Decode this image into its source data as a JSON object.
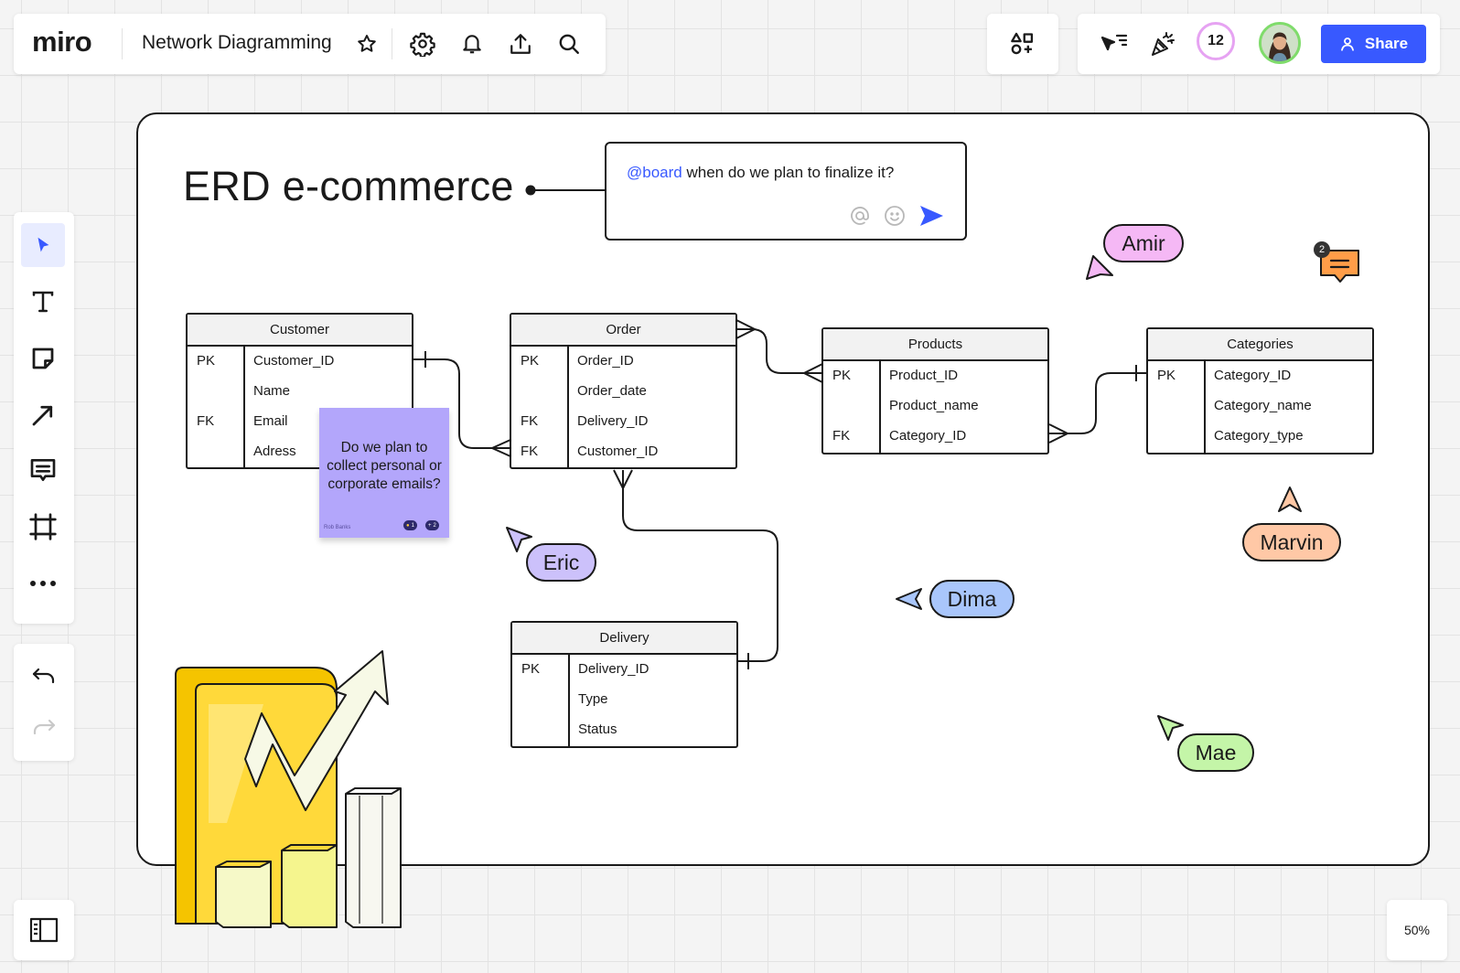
{
  "app": {
    "logo": "miro",
    "board_title": "Network Diagramming"
  },
  "topbar": {
    "collaborator_count": "12",
    "share_label": "Share"
  },
  "canvas": {
    "title": "ERD e-commerce",
    "comment": {
      "mention": "@board",
      "text": " when do we plan to finalize it?"
    },
    "tables": {
      "customer": {
        "title": "Customer",
        "rows": [
          {
            "key": "PK",
            "field": "Customer_ID"
          },
          {
            "key": "",
            "field": "Name"
          },
          {
            "key": "FK",
            "field": "Email"
          },
          {
            "key": "",
            "field": "Adress"
          }
        ]
      },
      "order": {
        "title": "Order",
        "rows": [
          {
            "key": "PK",
            "field": "Order_ID"
          },
          {
            "key": "",
            "field": "Order_date"
          },
          {
            "key": "FK",
            "field": "Delivery_ID"
          },
          {
            "key": "FK",
            "field": "Customer_ID"
          }
        ]
      },
      "products": {
        "title": "Products",
        "rows": [
          {
            "key": "PK",
            "field": "Product_ID"
          },
          {
            "key": "",
            "field": "Product_name"
          },
          {
            "key": "FK",
            "field": "Category_ID"
          }
        ]
      },
      "categories": {
        "title": "Categories",
        "rows": [
          {
            "key": "PK",
            "field": "Category_ID"
          },
          {
            "key": "",
            "field": "Category_name"
          },
          {
            "key": "",
            "field": "Category_type"
          }
        ]
      },
      "delivery": {
        "title": "Delivery",
        "rows": [
          {
            "key": "PK",
            "field": "Delivery_ID"
          },
          {
            "key": "",
            "field": "Type"
          },
          {
            "key": "",
            "field": "Status"
          }
        ]
      }
    },
    "sticky": {
      "text": "Do we plan to collect personal or corporate emails?",
      "author": "Rob Banks",
      "reaction_1": "1",
      "reaction_2": "2",
      "color": "#b3a6fb"
    },
    "cursors": [
      {
        "name": "Amir",
        "color": "#f5b8f5"
      },
      {
        "name": "Eric",
        "color": "#ccc1fb"
      },
      {
        "name": "Dima",
        "color": "#a9c6fb"
      },
      {
        "name": "Marvin",
        "color": "#ffc8a6"
      },
      {
        "name": "Mae",
        "color": "#c4f5a8"
      }
    ],
    "comment_badge": {
      "count": "2",
      "color": "#ff9d48"
    }
  },
  "zoom": "50%",
  "colors": {
    "accent": "#3859ff",
    "frame": "#1a1a1a"
  }
}
